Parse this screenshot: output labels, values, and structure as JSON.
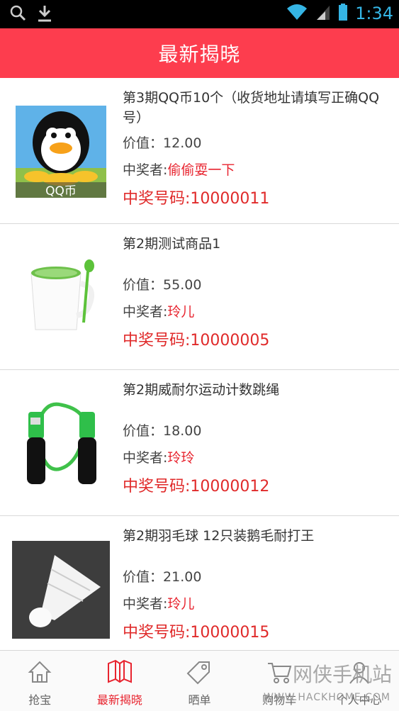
{
  "status_bar": {
    "time": "1:34"
  },
  "header": {
    "title": "最新揭晓"
  },
  "items": [
    {
      "title": "第3期QQ币10个（收货地址请填写正确QQ号）",
      "value_label": "价值：",
      "value": "12.00",
      "winner_label": "中奖者:",
      "winner": "偷偷耍一下",
      "code_label": "中奖号码:",
      "code": "10000011",
      "thumb_text": "QQ币"
    },
    {
      "title": "第2期测试商品1",
      "value_label": "价值：",
      "value": "55.00",
      "winner_label": "中奖者:",
      "winner": "玲儿",
      "code_label": "中奖号码:",
      "code": "10000005"
    },
    {
      "title": "第2期威耐尔运动计数跳绳",
      "value_label": "价值：",
      "value": "18.00",
      "winner_label": "中奖者:",
      "winner": "玲玲",
      "code_label": "中奖号码:",
      "code": "10000012"
    },
    {
      "title": "第2期羽毛球 12只装鹅毛耐打王",
      "value_label": "价值：",
      "value": "21.00",
      "winner_label": "中奖者:",
      "winner": "玲儿",
      "code_label": "中奖号码:",
      "code": "10000015"
    }
  ],
  "bottom_nav": [
    {
      "label": "抢宝",
      "icon": "home-icon"
    },
    {
      "label": "最新揭晓",
      "icon": "book-icon",
      "active": true
    },
    {
      "label": "晒单",
      "icon": "tag-icon"
    },
    {
      "label": "购物车",
      "icon": "cart-icon"
    },
    {
      "label": "个人中心",
      "icon": "user-icon"
    }
  ],
  "watermark": {
    "text": "网侠手机站",
    "url": "WWW.HACKHOME.COM"
  },
  "colors": {
    "accent": "#fd3d4e",
    "winner": "#e8242f",
    "status_time": "#35b5e5"
  }
}
